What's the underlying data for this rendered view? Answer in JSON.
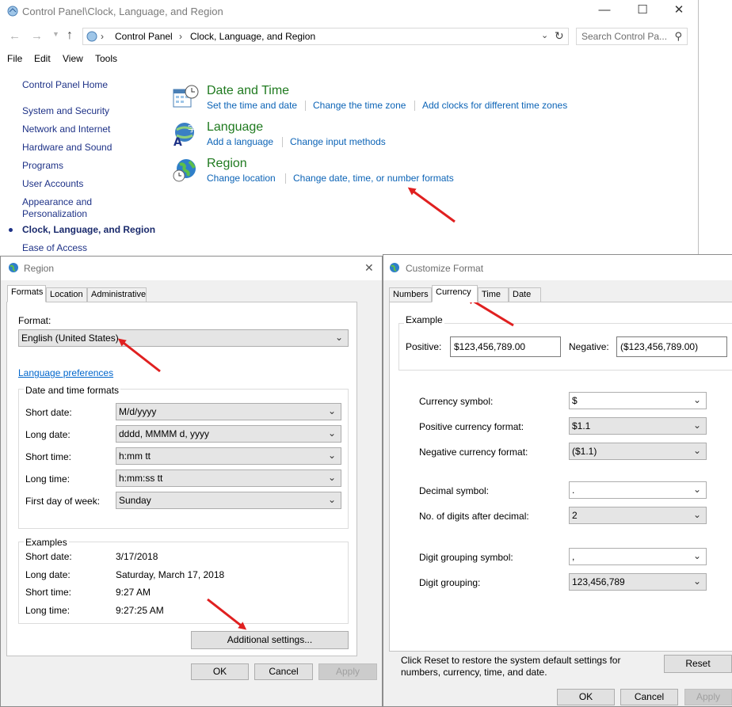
{
  "control_panel": {
    "title": "Control Panel\\Clock, Language, and Region",
    "breadcrumb": [
      "Control Panel",
      "Clock, Language, and Region"
    ],
    "search_placeholder": "Search Control Pa...",
    "menu": [
      "File",
      "Edit",
      "View",
      "Tools"
    ],
    "sidebar": [
      "Control Panel Home",
      "System and Security",
      "Network and Internet",
      "Hardware and Sound",
      "Programs",
      "User Accounts",
      "Appearance and",
      "Personalization",
      "Clock, Language, and Region",
      "Ease of Access"
    ],
    "categories": [
      {
        "title": "Date and Time",
        "links": [
          "Set the time and date",
          "Change the time zone",
          "Add clocks for different time zones"
        ]
      },
      {
        "title": "Language",
        "links": [
          "Add a language",
          "Change input methods"
        ]
      },
      {
        "title": "Region",
        "links": [
          "Change location",
          "Change date, time, or number formats"
        ]
      }
    ]
  },
  "region_dialog": {
    "title": "Region",
    "tabs": [
      "Formats",
      "Location",
      "Administrative"
    ],
    "format_label": "Format:",
    "format_value": "English (United States)",
    "language_prefs": "Language preferences",
    "datetime_group": "Date and time formats",
    "rows": [
      {
        "label": "Short date:",
        "value": "M/d/yyyy"
      },
      {
        "label": "Long date:",
        "value": "dddd, MMMM d, yyyy"
      },
      {
        "label": "Short time:",
        "value": "h:mm tt"
      },
      {
        "label": "Long time:",
        "value": "h:mm:ss tt"
      },
      {
        "label": "First day of week:",
        "value": "Sunday"
      }
    ],
    "examples_group": "Examples",
    "examples": [
      {
        "label": "Short date:",
        "value": "3/17/2018"
      },
      {
        "label": "Long date:",
        "value": "Saturday, March 17, 2018"
      },
      {
        "label": "Short time:",
        "value": "9:27 AM"
      },
      {
        "label": "Long time:",
        "value": "9:27:25 AM"
      }
    ],
    "additional_settings": "Additional settings...",
    "ok": "OK",
    "cancel": "Cancel",
    "apply": "Apply"
  },
  "customize_dialog": {
    "title": "Customize Format",
    "tabs": [
      "Numbers",
      "Currency",
      "Time",
      "Date"
    ],
    "example_group": "Example",
    "positive_label": "Positive:",
    "positive_value": "$123,456,789.00",
    "negative_label": "Negative:",
    "negative_value": "($123,456,789.00)",
    "rows": [
      {
        "label": "Currency symbol:",
        "value": "$"
      },
      {
        "label": "Positive currency format:",
        "value": "$1.1"
      },
      {
        "label": "Negative currency format:",
        "value": "($1.1)"
      },
      {
        "label": "Decimal symbol:",
        "value": "."
      },
      {
        "label": "No. of digits after decimal:",
        "value": "2"
      },
      {
        "label": "Digit grouping symbol:",
        "value": ","
      },
      {
        "label": "Digit grouping:",
        "value": "123,456,789"
      }
    ],
    "reset_note_1": "Click Reset to restore the system default settings for",
    "reset_note_2": "numbers, currency, time, and date.",
    "reset": "Reset",
    "ok": "OK",
    "cancel": "Cancel",
    "apply": "Apply"
  },
  "colors": {
    "link": "#0b63b6",
    "category_title": "#1f7a1f",
    "arrow": "#e02020"
  }
}
